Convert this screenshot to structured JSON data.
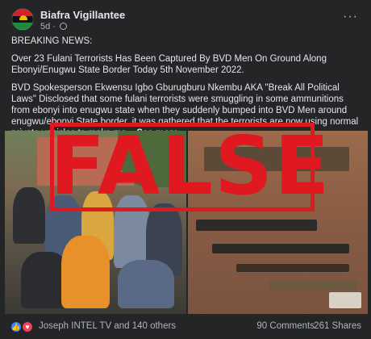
{
  "post": {
    "page_name": "Biafra Vigillantee",
    "time": "5d",
    "privacy_icon": "globe-icon",
    "more_icon": "more-options-icon",
    "paragraphs": [
      "BREAKING NEWS:",
      "Over 23 Fulani Terrorists Has Been Captured By BVD Men On Ground Along Ebonyi/Enugwu State Border Today 5th November 2022.",
      "BVD Spokesperson Ekwensu Igbo Gburugburu Nkembu AKA \"Break All Political Laws\" Disclosed that some fulani terrorists were smuggling in some ammunitions from ebonyi into enugwu state when they suddenly bumped into BVD Men around enugwu/ebonyi State border, it was gathered that the terrorists are now using normal private vehicles to make ma..."
    ],
    "see_more": "See more"
  },
  "overlay": {
    "stamp_text": "FALSE",
    "stamp_color": "#e0181f"
  },
  "footer": {
    "reactions": [
      "like-reaction-icon",
      "love-reaction-icon"
    ],
    "reaction_text": "Joseph INTEL TV and 140 others",
    "comments": "90 Comments",
    "shares": "261 Shares"
  },
  "colors": {
    "background": "#242526",
    "primary_text": "#e4e6eb",
    "secondary_text": "#b0b3b8",
    "like_blue": "#2d88ff",
    "love_red": "#f33e58"
  }
}
